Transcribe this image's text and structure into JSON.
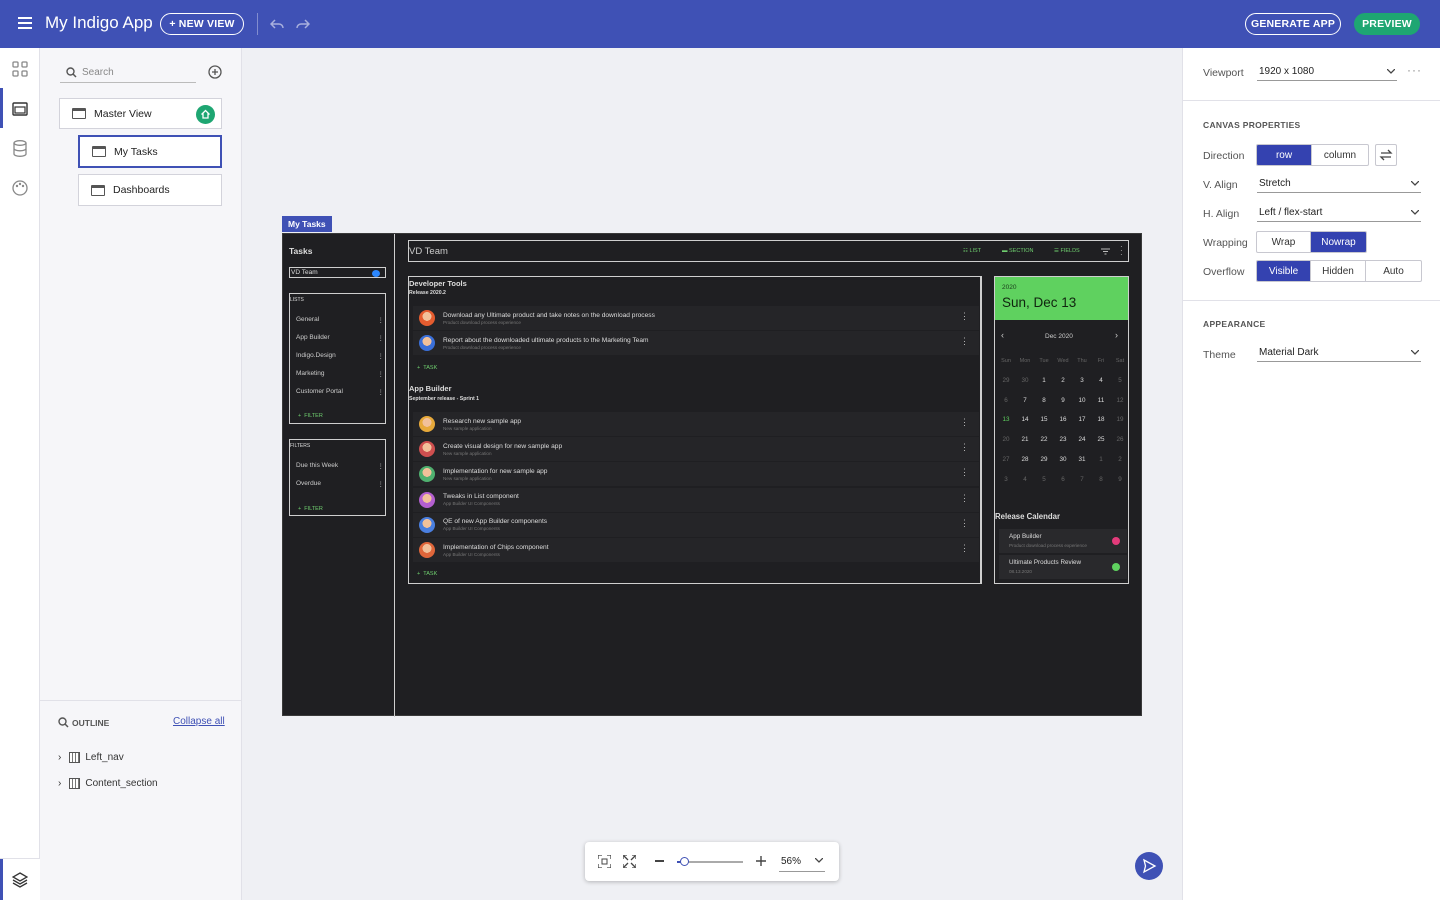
{
  "topbar": {
    "app_title": "My Indigo App",
    "new_view_label": "+ NEW VIEW",
    "generate_label": "GENERATE APP",
    "preview_label": "PREVIEW",
    "bg_color": "#3f51b5",
    "preview_color": "#1ea672"
  },
  "left_panel": {
    "search_placeholder": "Search",
    "views": [
      {
        "label": "Master View"
      },
      {
        "label": "My Tasks"
      },
      {
        "label": "Dashboards"
      }
    ],
    "outline": {
      "title": "OUTLINE",
      "collapse_label": "Collapse all",
      "items": [
        {
          "label": "Left_nav"
        },
        {
          "label": "Content_section"
        }
      ]
    }
  },
  "canvas": {
    "view_tag": "My Tasks",
    "nav": {
      "title": "Tasks",
      "team_field": "VD Team",
      "lists_title": "LISTS",
      "lists": [
        "General",
        "App Builder",
        "Indigo.Design",
        "Marketing",
        "Customer Portal"
      ],
      "filter_label": "FILTER",
      "filters_title": "FILTERS",
      "filters": [
        "Due this Week",
        "Overdue"
      ]
    },
    "header": {
      "title": "VD Team",
      "list_label": "LIST",
      "section_label": "SECTION",
      "fields_label": "FIELDS"
    },
    "groups": [
      {
        "title": "Developer Tools",
        "subtitle": "Release 2020.2",
        "tasks": [
          {
            "title": "Download any Ultimate product and take notes on the download process",
            "sub": "Product download process experience"
          },
          {
            "title": "Report about the downloaded ultimate products to the Marketing Team",
            "sub": "Product download process experience"
          }
        ],
        "add_label": "TASK"
      },
      {
        "title": "App Builder",
        "subtitle": "September release - Sprint 1",
        "tasks": [
          {
            "title": "Research new sample app",
            "sub": "New sample application"
          },
          {
            "title": "Create visual design for new sample app",
            "sub": "New sample application"
          },
          {
            "title": "Implementation for new sample app",
            "sub": "New sample application"
          },
          {
            "title": "Tweaks in List component",
            "sub": "App Builder UI Components"
          },
          {
            "title": "QE of new App Builder components",
            "sub": "App Builder UI Components"
          },
          {
            "title": "Implementation of Chips component",
            "sub": "App Builder UI Components"
          }
        ],
        "add_label": "TASK"
      }
    ],
    "calendar": {
      "year": "2020",
      "date_label": "Sun, Dec 13",
      "month_label": "Dec 2020",
      "weekdays": [
        "Sun",
        "Mon",
        "Tue",
        "Wed",
        "Thu",
        "Fri",
        "Sat"
      ],
      "weeks": [
        [
          "29",
          "30",
          "1",
          "2",
          "3",
          "4",
          "5"
        ],
        [
          "6",
          "7",
          "8",
          "9",
          "10",
          "11",
          "12"
        ],
        [
          "13",
          "14",
          "15",
          "16",
          "17",
          "18",
          "19"
        ],
        [
          "20",
          "21",
          "22",
          "23",
          "24",
          "25",
          "26"
        ],
        [
          "27",
          "28",
          "29",
          "30",
          "31",
          "1",
          "2"
        ],
        [
          "3",
          "4",
          "5",
          "6",
          "7",
          "8",
          "9"
        ]
      ],
      "accent": "#5fd15f"
    },
    "release": {
      "title": "Release Calendar",
      "items": [
        {
          "title": "App Builder",
          "sub": "Product download process experience"
        },
        {
          "title": "Ultimate Products Review",
          "sub": "08.13.2020"
        }
      ]
    }
  },
  "zoom": {
    "value": "56%",
    "level": 0.1
  },
  "right_panel": {
    "viewport_label": "Viewport",
    "viewport_value": "1920 x 1080",
    "canvas_props_title": "CANVAS PROPERTIES",
    "direction_label": "Direction",
    "direction_options": [
      "row",
      "column"
    ],
    "valign_label": "V. Align",
    "valign_value": "Stretch",
    "halign_label": "H. Align",
    "halign_value": "Left / flex-start",
    "wrapping_label": "Wrapping",
    "wrapping_options": [
      "Wrap",
      "Nowrap"
    ],
    "overflow_label": "Overflow",
    "overflow_options": [
      "Visible",
      "Hidden",
      "Auto"
    ],
    "appearance_title": "APPEARANCE",
    "theme_label": "Theme",
    "theme_value": "Material Dark"
  }
}
